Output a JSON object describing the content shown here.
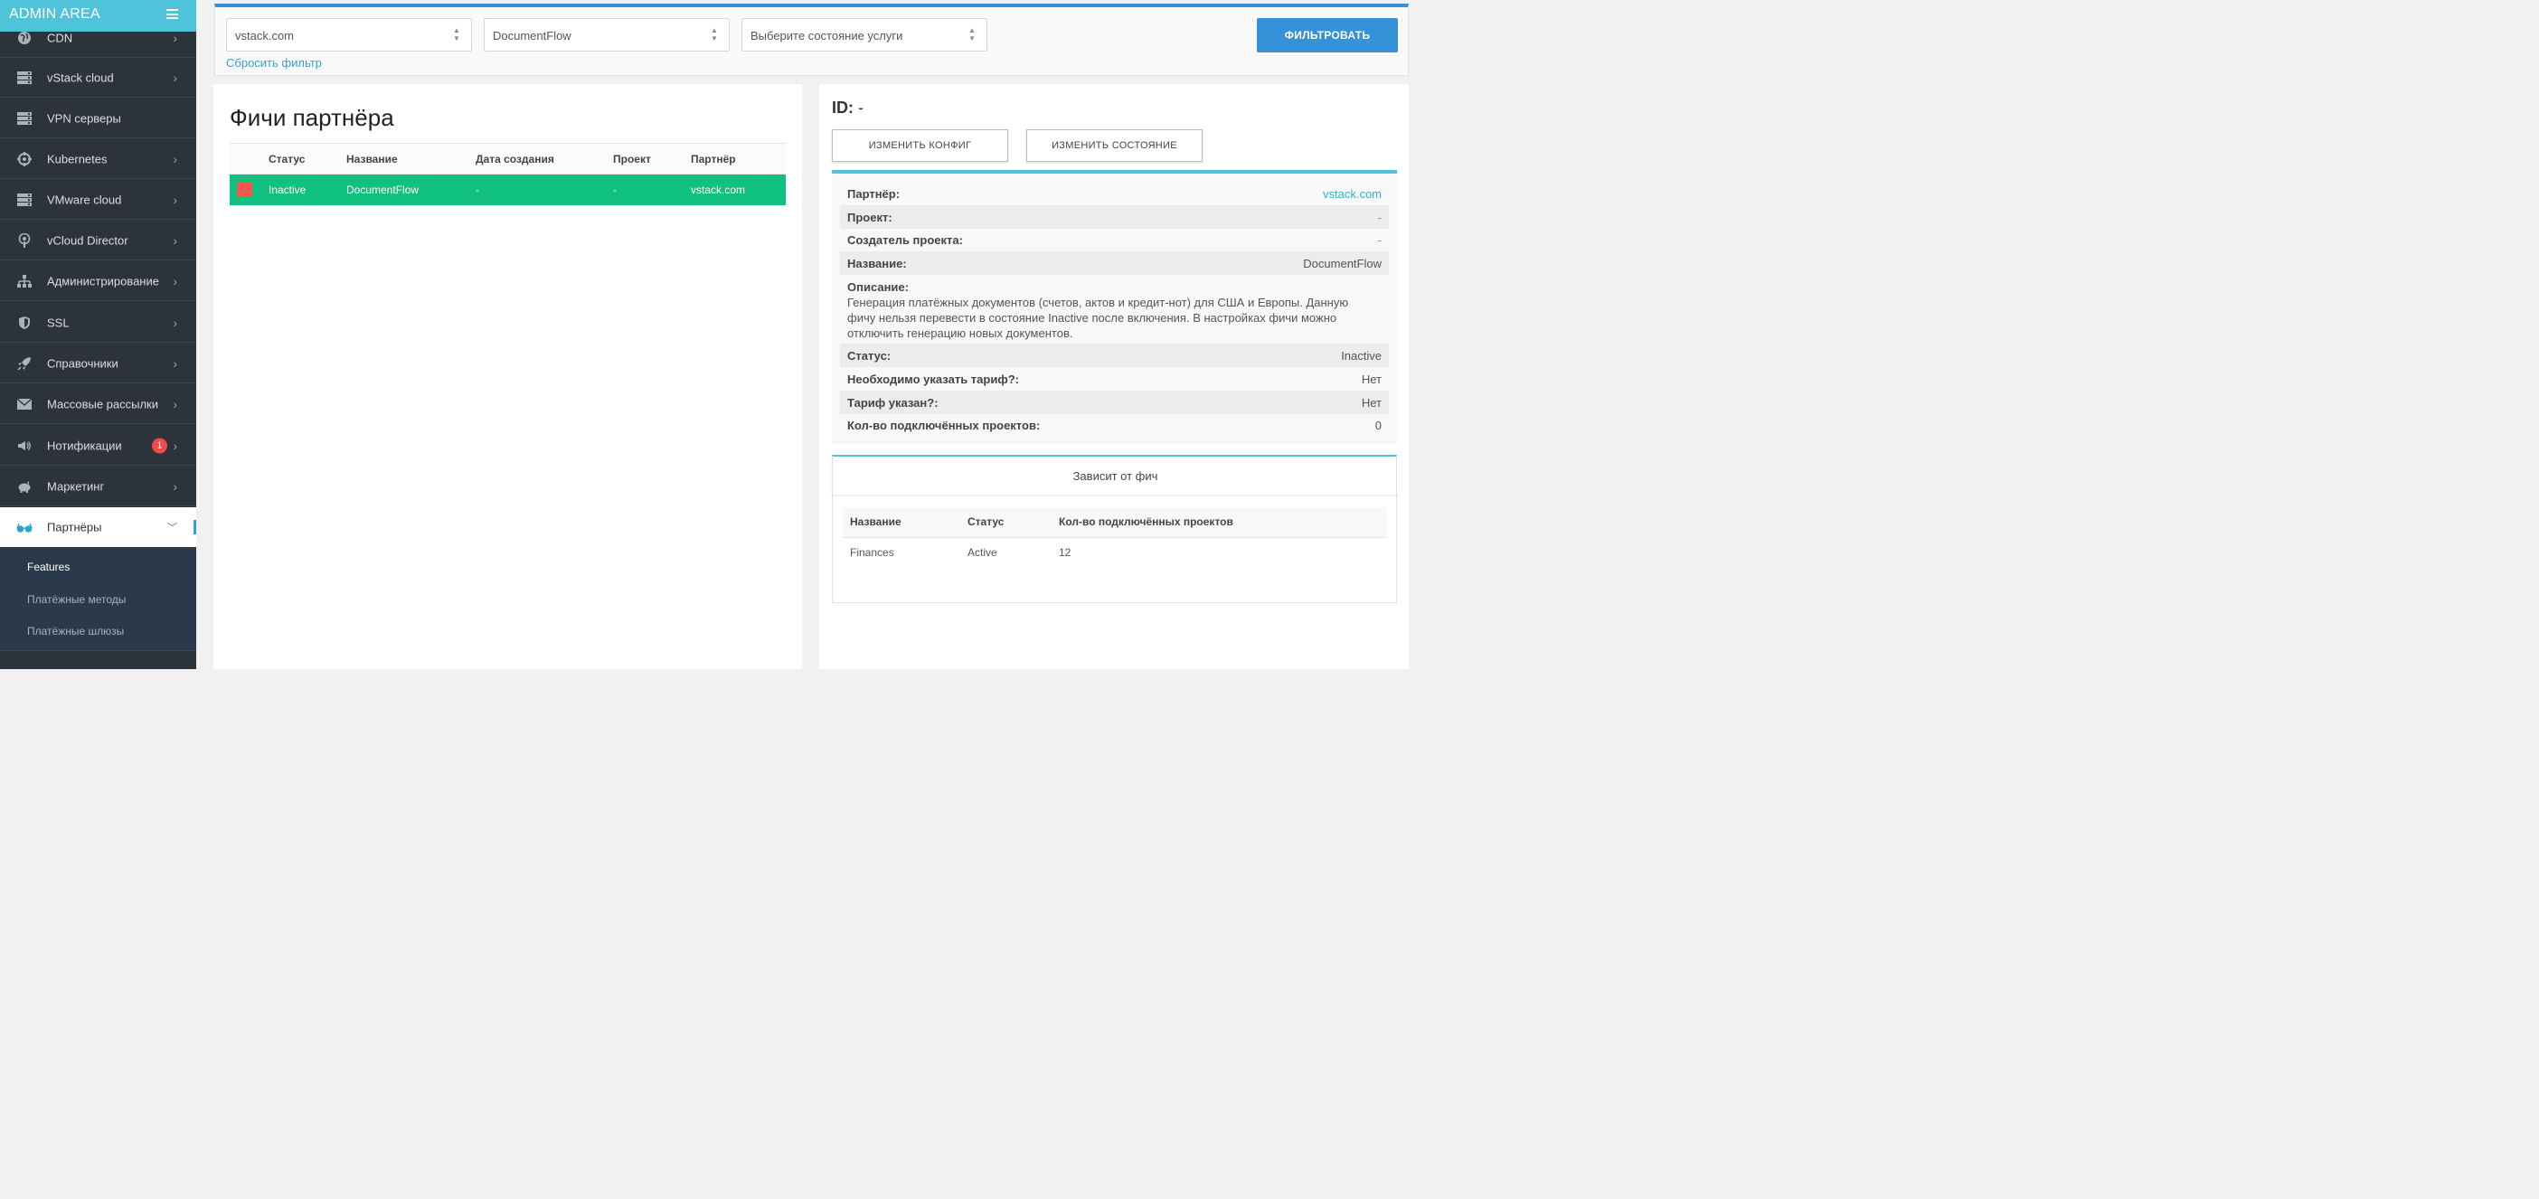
{
  "sidebar": {
    "title": "ADMIN AREA",
    "items": [
      {
        "label": "CDN",
        "icon": "globe-icon"
      },
      {
        "label": "vStack cloud",
        "icon": "server-icon"
      },
      {
        "label": "VPN серверы",
        "icon": "server-icon"
      },
      {
        "label": "Kubernetes",
        "icon": "helm-icon"
      },
      {
        "label": "VMware cloud",
        "icon": "server-icon"
      },
      {
        "label": "vCloud Director",
        "icon": "podcast-icon"
      },
      {
        "label": "Администрирование",
        "icon": "sitemap-icon"
      },
      {
        "label": "SSL",
        "icon": "shield-icon"
      },
      {
        "label": "Справочники",
        "icon": "rocket-icon"
      },
      {
        "label": "Массовые рассылки",
        "icon": "envelope-icon"
      },
      {
        "label": "Нотификации",
        "icon": "megaphone-icon",
        "badge": "1"
      },
      {
        "label": "Маркетинг",
        "icon": "piggy-bank-icon"
      },
      {
        "label": "Партнёры",
        "icon": "glasses-icon"
      }
    ],
    "subitems": [
      "Features",
      "Платёжные методы",
      "Платёжные шлюзы"
    ]
  },
  "filters": {
    "partner": "vstack.com",
    "feature": "DocumentFlow",
    "state": "Выберите состояние услуги",
    "button": "ФИЛЬТРОВАТЬ",
    "reset": "Сбросить фильтр"
  },
  "features_panel": {
    "title": "Фичи партнёра",
    "columns": [
      "Статус",
      "Название",
      "Дата создания",
      "Проект",
      "Партнёр"
    ],
    "rows": [
      {
        "status": "Inactive",
        "name": "DocumentFlow",
        "created": "-",
        "project": "-",
        "partner": "vstack.com"
      }
    ]
  },
  "details": {
    "id_label": "ID:",
    "id_value": "-",
    "btn_config": "ИЗМЕНИТЬ КОНФИГ",
    "btn_state": "ИЗМЕНИТЬ СОСТОЯНИЕ",
    "partner_k": "Партнёр:",
    "partner_v": "vstack.com",
    "project_k": "Проект:",
    "project_v": "-",
    "creator_k": "Создатель проекта:",
    "creator_v": "-",
    "name_k": "Название:",
    "name_v": "DocumentFlow",
    "desc_k": "Описание:",
    "desc_v": "Генерация платёжных документов (счетов, актов и кредит-нот) для США и Европы. Данную фичу нельзя перевести в состояние Inactive после включения. В настройках фичи можно отключить генерацию новых документов.",
    "status_k": "Статус:",
    "status_v": "Inactive",
    "tariff_req_k": "Необходимо указать тариф?:",
    "tariff_req_v": "Нет",
    "tariff_set_k": "Тариф указан?:",
    "tariff_set_v": "Нет",
    "projects_k": "Кол-во подключённых проектов:",
    "projects_v": "0"
  },
  "dependencies": {
    "title": "Зависит от фич",
    "columns": [
      "Название",
      "Статус",
      "Кол-во подключённых проектов"
    ],
    "rows": [
      {
        "name": "Finances",
        "status": "Active",
        "count": "12"
      }
    ]
  },
  "colors": {
    "accent": "#4fc3d9",
    "primary": "#3592d8",
    "selected_row": "#0fc07e",
    "inactive_marker": "#f0574f",
    "sidebar_bg": "#2d333b"
  }
}
